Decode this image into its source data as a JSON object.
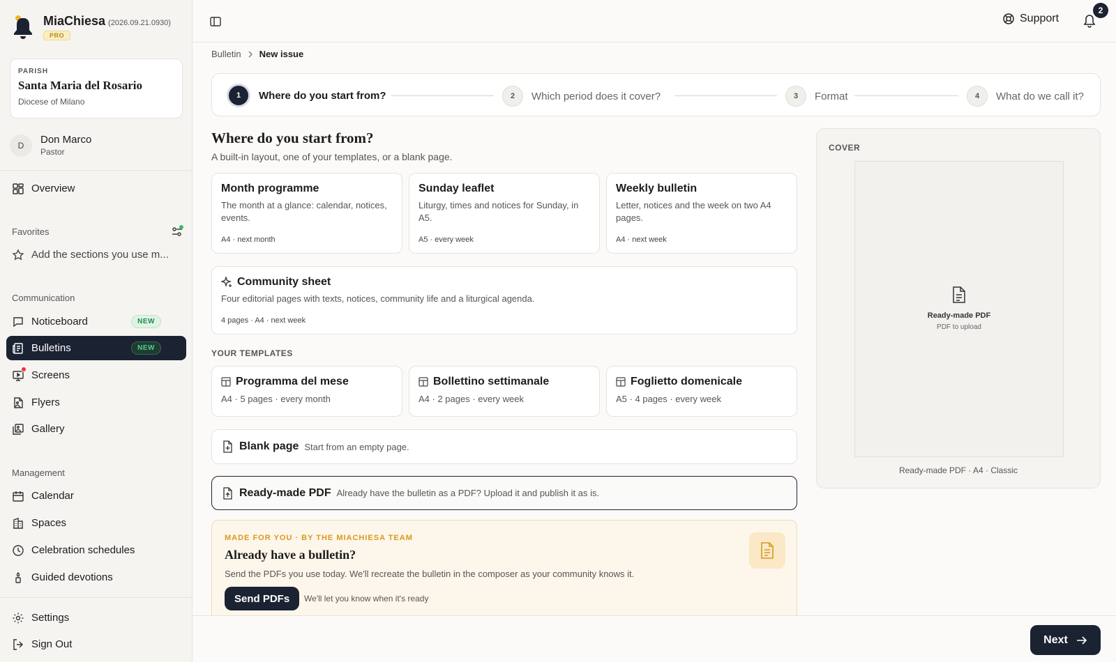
{
  "app": {
    "name": "MiaChiesa",
    "version": "(2026.09.21.0930)",
    "plan": "PRO"
  },
  "parish": {
    "label": "PARISH",
    "name": "Santa Maria del Rosario",
    "diocese": "Diocese of Milano"
  },
  "user": {
    "initial": "D",
    "name": "Don Marco",
    "role": "Pastor"
  },
  "nav": {
    "overview": "Overview",
    "favorites_label": "Favorites",
    "favorites_hint": "Add the sections you use m...",
    "communication_label": "Communication",
    "noticeboard": "Noticeboard",
    "bulletins": "Bulletins",
    "new_badge": "NEW",
    "screens": "Screens",
    "flyers": "Flyers",
    "gallery": "Gallery",
    "management_label": "Management",
    "calendar": "Calendar",
    "spaces": "Spaces",
    "celebration": "Celebration schedules",
    "devotions": "Guided devotions",
    "settings": "Settings",
    "signout": "Sign Out"
  },
  "topbar": {
    "support": "Support",
    "notifications": "2"
  },
  "breadcrumb": {
    "parent": "Bulletin",
    "current": "New issue"
  },
  "steps": [
    {
      "num": "1",
      "label": "Where do you start from?"
    },
    {
      "num": "2",
      "label": "Which period does it cover?"
    },
    {
      "num": "3",
      "label": "Format"
    },
    {
      "num": "4",
      "label": "What do we call it?"
    }
  ],
  "section": {
    "title": "Where do you start from?",
    "subtitle": "A built-in layout, one of your templates, or a blank page."
  },
  "layouts": [
    {
      "title": "Month programme",
      "desc": "The month at a glance: calendar, notices, events.",
      "meta": "A4 · next month"
    },
    {
      "title": "Sunday leaflet",
      "desc": "Liturgy, times and notices for Sunday, in A5.",
      "meta": "A5 · every week"
    },
    {
      "title": "Weekly bulletin",
      "desc": "Letter, notices and the week on two A4 pages.",
      "meta": "A4 · next week"
    }
  ],
  "community": {
    "title": "Community sheet",
    "desc": "Four editorial pages with texts, notices, community life and a liturgical agenda.",
    "meta": "4 pages · A4 · next week"
  },
  "templates_label": "YOUR TEMPLATES",
  "templates": [
    {
      "title": "Programma del mese",
      "meta": "A4 · 5 pages · every month"
    },
    {
      "title": "Bollettino settimanale",
      "meta": "A4 · 2 pages · every week"
    },
    {
      "title": "Foglietto domenicale",
      "meta": "A5 · 4 pages · every week"
    }
  ],
  "blank": {
    "title": "Blank page",
    "desc": "Start from an empty page."
  },
  "pdf": {
    "title": "Ready-made PDF",
    "desc": "Already have the bulletin as a PDF? Upload it and publish it as is."
  },
  "promo": {
    "eyebrow": "MADE FOR YOU · BY THE MIACHIESA TEAM",
    "title": "Already have a bulletin?",
    "desc": "Send the PDFs you use today. We'll recreate the bulletin in the composer as your community knows it.",
    "button": "Send PDFs",
    "note": "We'll let you know when it's ready"
  },
  "cover": {
    "label": "COVER",
    "title": "Ready-made PDF",
    "sub": "PDF to upload",
    "caption": "Ready-made PDF · A4 · Classic"
  },
  "footer": {
    "next": "Next"
  },
  "colors": {
    "primary": "#1b2232",
    "accent_gold": "#d89a1e",
    "success": "#1f8a4c",
    "alert": "#e33333"
  }
}
